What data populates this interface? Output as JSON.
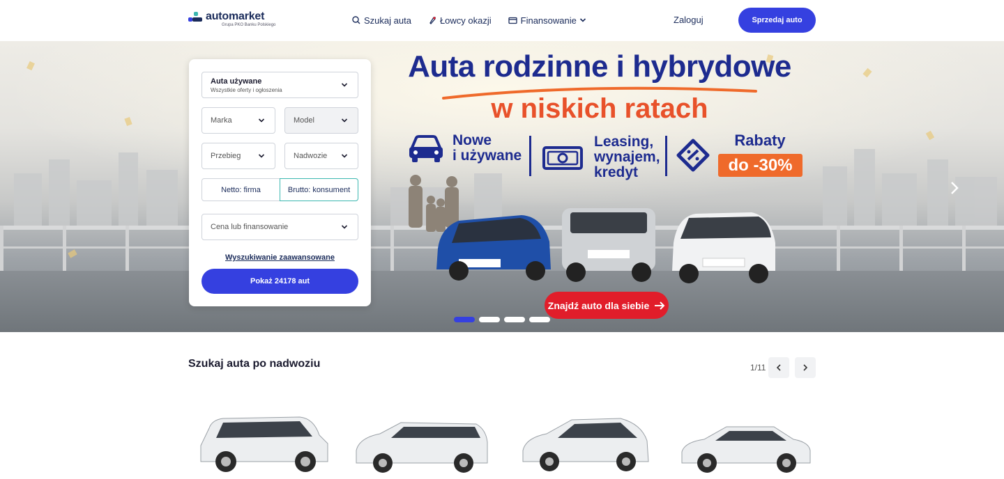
{
  "header": {
    "logo_name": "automarket",
    "logo_sub": "Grupa PKO Banku Polskiego",
    "nav": [
      {
        "label": "Szukaj auta",
        "icon": "search-icon"
      },
      {
        "label": "Łowcy okazji",
        "icon": "rocket-icon"
      },
      {
        "label": "Finansowanie",
        "icon": "wallet-icon"
      }
    ],
    "login_label": "Zaloguj",
    "sell_label": "Sprzedaj auto"
  },
  "hero": {
    "title": "Auta rodzinne i hybrydowe",
    "subtitle": "w niskich ratach",
    "features": [
      {
        "line1": "Nowe",
        "line2": "i używane",
        "icon": "car-icon"
      },
      {
        "line1": "Leasing,",
        "line2": "wynajem,",
        "line3": "kredyt",
        "icon": "money-icon"
      }
    ],
    "rabaty_label": "Rabaty",
    "rabaty_badge": "do -30%",
    "cta_label": "Znajdź auto dla siebie",
    "slides": 4,
    "active_slide": 1
  },
  "search": {
    "category_main": "Auta używane",
    "category_sub": "Wszystkie oferty i ogłoszenia",
    "make_placeholder": "Marka",
    "model_placeholder": "Model",
    "mileage_placeholder": "Przebieg",
    "body_placeholder": "Nadwozie",
    "toggle_net": "Netto: firma",
    "toggle_gross": "Brutto: konsument",
    "price_placeholder": "Cena lub finansowanie",
    "advanced_link": "Wyszukiwanie zaawansowane",
    "show_button": "Pokaż 24178 aut"
  },
  "body_section": {
    "title": "Szukaj auta po nadwoziu",
    "pager": "1/11"
  },
  "colors": {
    "brand_blue": "#3540e0",
    "title_blue": "#1d2b8f",
    "orange": "#ef6a2b",
    "cta_red": "#e11d2a"
  }
}
